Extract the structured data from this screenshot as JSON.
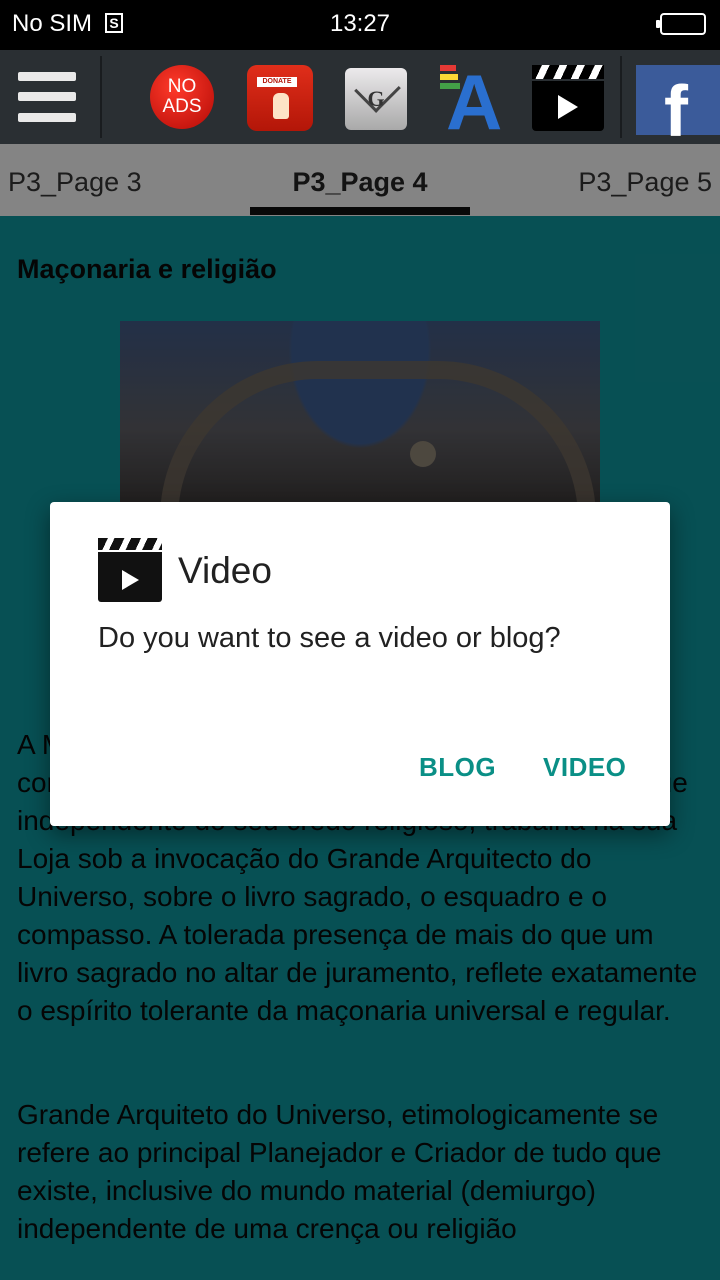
{
  "status_bar": {
    "carrier": "No SIM",
    "sim_icon": "S",
    "time": "13:27"
  },
  "toolbar": {
    "no_ads": {
      "line1": "NO",
      "line2": "ADS"
    },
    "donate_label": "DONATE",
    "freemasonry_letter": "G",
    "font_letter": "A",
    "facebook_letter": "f"
  },
  "tabs": {
    "prev": "P3_Page 3",
    "current": "P3_Page 4",
    "next": "P3_Page 5"
  },
  "content": {
    "heading": "Maçonaria e religião",
    "paragraph1": "A Maçonaria não é uma religião, nem uma seita, é composta por homens livres e de bons costumes, que independente do seu credo religioso, trabalha na sua Loja sob a invocação do Grande Arquitecto do Universo, sobre o livro sagrado, o esquadro e o compasso. A tolerada presença de mais do que um livro sagrado no altar de juramento, reflete exatamente o espírito tolerante da maçonaria universal e regular.",
    "paragraph2": "Grande Arquiteto do Universo, etimologicamente se refere ao principal Planejador e Criador de tudo que existe, inclusive do mundo material (demiurgo) independente de uma crença ou religião"
  },
  "dialog": {
    "title": "Video",
    "message": "Do you want to see a video or blog?",
    "buttons": {
      "blog": "BLOG",
      "video": "VIDEO"
    }
  },
  "colors": {
    "accent": "#0a8f86",
    "content_bg": "#0e8f96",
    "toolbar_bg": "#2a2f33"
  }
}
